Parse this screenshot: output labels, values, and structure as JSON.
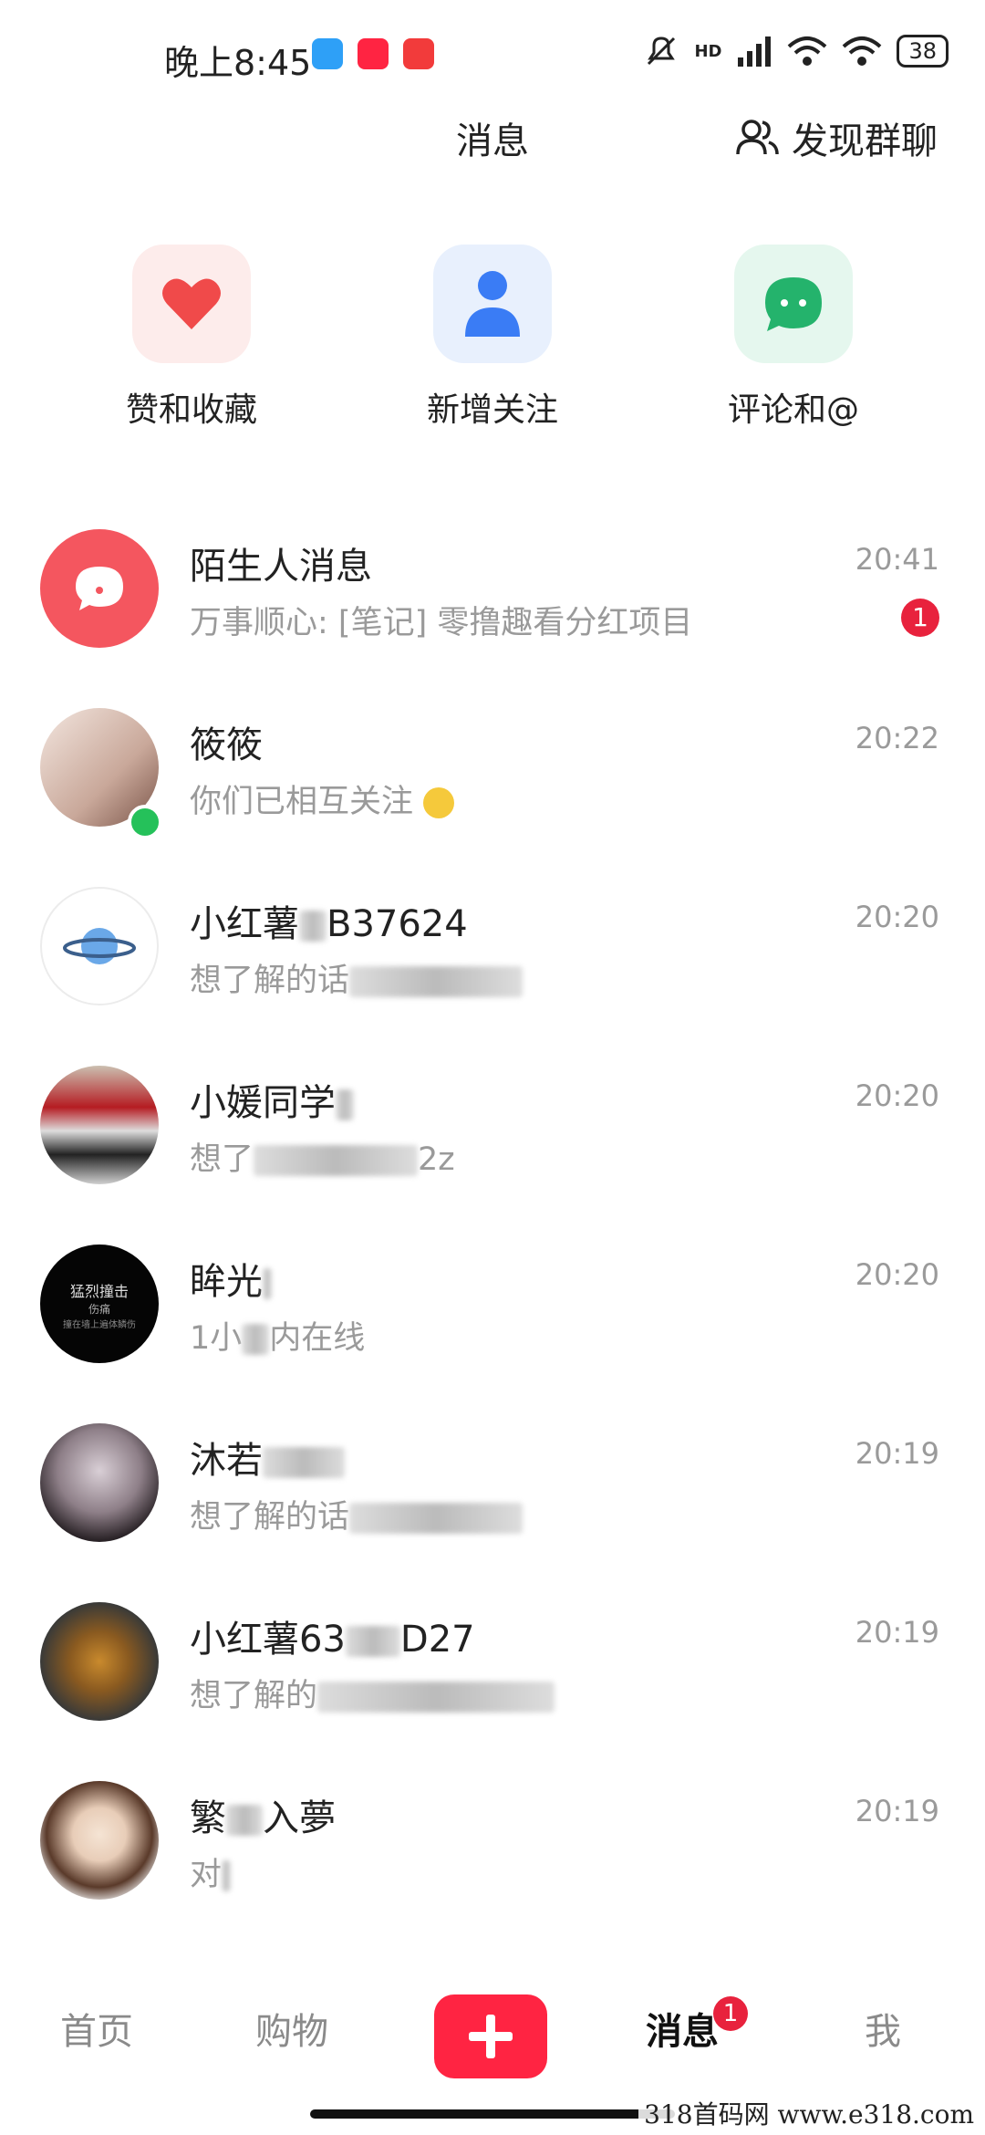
{
  "status_bar": {
    "time": "晚上8:45",
    "battery": "38",
    "hd": "HD"
  },
  "header": {
    "title": "消息",
    "discover": "发现群聊"
  },
  "quick_actions": [
    {
      "label": "赞和收藏",
      "icon": "heart-icon",
      "bg": "#fdeceb",
      "color": "#f04a4a"
    },
    {
      "label": "新增关注",
      "icon": "person-icon",
      "bg": "#e8f0fd",
      "color": "#3a7cf5"
    },
    {
      "label": "评论和@",
      "icon": "comment-icon",
      "bg": "#e5f7ee",
      "color": "#24b36c"
    }
  ],
  "conversations": [
    {
      "name": "陌生人消息",
      "message": "万事顺心: [笔记] 零撸趣看分红项目",
      "time": "20:41",
      "badge": "1"
    },
    {
      "name": "筱筱",
      "message": "你们已相互关注",
      "time": "20:22"
    },
    {
      "name": "小红薯",
      "name_suffix": "B37624",
      "message": "想了解的话",
      "time": "20:20"
    },
    {
      "name": "小媛同学",
      "message": "想了",
      "message_suffix": "2z",
      "time": "20:20"
    },
    {
      "name": "眸光",
      "message": "1小",
      "message_suffix": "内在线",
      "time": "20:20"
    },
    {
      "name": "沐若",
      "message": "想了解的话",
      "time": "20:19"
    },
    {
      "name": "小红薯63",
      "name_suffix": "D27",
      "message": "想了解的",
      "time": "20:19"
    },
    {
      "name": "繁",
      "name_suffix": "入夢",
      "message": "对",
      "time": "20:19"
    }
  ],
  "avatar_text": {
    "line1": "猛烈撞击",
    "line2": "伤痛",
    "line3": "撞在墙上遍体鳞伤"
  },
  "tabbar": {
    "home": "首页",
    "shop": "购物",
    "messages": "消息",
    "me": "我",
    "messages_badge": "1"
  },
  "colors": {
    "brand": "#ff2442",
    "badge": "#e8223d",
    "online": "#25c15a"
  },
  "watermark": "318首码网 www.e318.com"
}
